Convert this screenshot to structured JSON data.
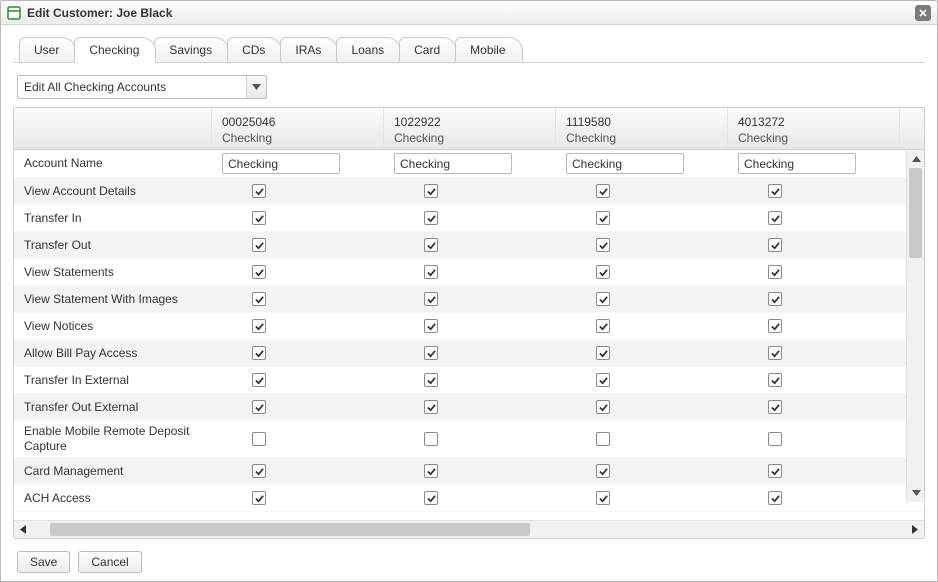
{
  "window": {
    "title": "Edit Customer: Joe Black"
  },
  "tabs": [
    {
      "label": "User"
    },
    {
      "label": "Checking"
    },
    {
      "label": "Savings"
    },
    {
      "label": "CDs"
    },
    {
      "label": "IRAs"
    },
    {
      "label": "Loans"
    },
    {
      "label": "Card"
    },
    {
      "label": "Mobile"
    }
  ],
  "active_tab_index": 1,
  "filter": {
    "selected": "Edit All Checking Accounts"
  },
  "columns": [
    {
      "id": "00025046",
      "type": "Checking",
      "name_value": "Checking"
    },
    {
      "id": "1022922",
      "type": "Checking",
      "name_value": "Checking"
    },
    {
      "id": "1119580",
      "type": "Checking",
      "name_value": "Checking"
    },
    {
      "id": "4013272",
      "type": "Checking",
      "name_value": "Checking"
    }
  ],
  "rows": [
    {
      "label": "Account Name",
      "kind": "text"
    },
    {
      "label": "View Account Details",
      "kind": "check",
      "values": [
        true,
        true,
        true,
        true
      ]
    },
    {
      "label": "Transfer In",
      "kind": "check",
      "values": [
        true,
        true,
        true,
        true
      ]
    },
    {
      "label": "Transfer Out",
      "kind": "check",
      "values": [
        true,
        true,
        true,
        true
      ]
    },
    {
      "label": "View Statements",
      "kind": "check",
      "values": [
        true,
        true,
        true,
        true
      ]
    },
    {
      "label": "View Statement With Images",
      "kind": "check",
      "values": [
        true,
        true,
        true,
        true
      ]
    },
    {
      "label": "View Notices",
      "kind": "check",
      "values": [
        true,
        true,
        true,
        true
      ]
    },
    {
      "label": "Allow Bill Pay Access",
      "kind": "check",
      "values": [
        true,
        true,
        true,
        true
      ]
    },
    {
      "label": "Transfer In External",
      "kind": "check",
      "values": [
        true,
        true,
        true,
        true
      ]
    },
    {
      "label": "Transfer Out External",
      "kind": "check",
      "values": [
        true,
        true,
        true,
        true
      ]
    },
    {
      "label": "Enable Mobile Remote Deposit Capture",
      "kind": "check",
      "values": [
        false,
        false,
        false,
        false
      ]
    },
    {
      "label": "Card Management",
      "kind": "check",
      "values": [
        true,
        true,
        true,
        true
      ]
    },
    {
      "label": "ACH Access",
      "kind": "check",
      "values": [
        true,
        true,
        true,
        true
      ]
    }
  ],
  "footer": {
    "save": "Save",
    "cancel": "Cancel"
  }
}
